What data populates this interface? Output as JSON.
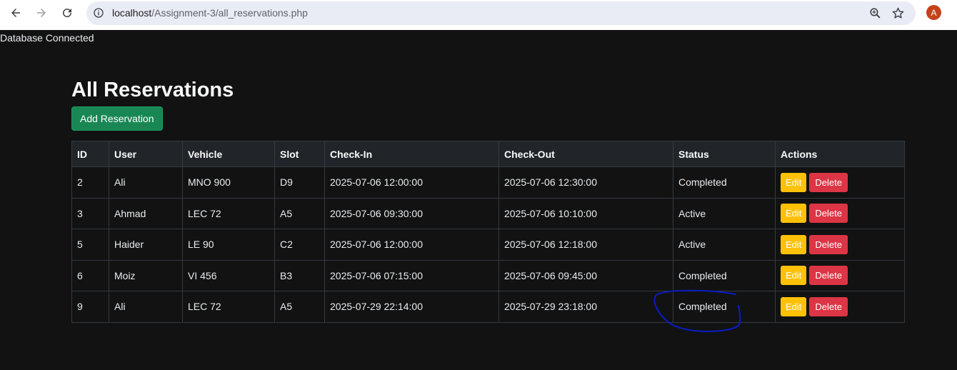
{
  "browser": {
    "url_host": "localhost",
    "url_path": "/Assignment-3/all_reservations.php",
    "profile_initial": "A",
    "icons": [
      "back-icon",
      "forward-icon",
      "reload-icon",
      "info-icon",
      "zoom-icon",
      "star-icon"
    ]
  },
  "status_text": "Database Connected",
  "page": {
    "title": "All Reservations",
    "add_button": "Add Reservation"
  },
  "table": {
    "headers": [
      "ID",
      "User",
      "Vehicle",
      "Slot",
      "Check-In",
      "Check-Out",
      "Status",
      "Actions"
    ],
    "rows": [
      {
        "id": "2",
        "user": "Ali",
        "vehicle": "MNO 900",
        "slot": "D9",
        "check_in": "2025-07-06 12:00:00",
        "check_out": "2025-07-06 12:30:00",
        "status": "Completed"
      },
      {
        "id": "3",
        "user": "Ahmad",
        "vehicle": "LEC 72",
        "slot": "A5",
        "check_in": "2025-07-06 09:30:00",
        "check_out": "2025-07-06 10:10:00",
        "status": "Active"
      },
      {
        "id": "5",
        "user": "Haider",
        "vehicle": "LE 90",
        "slot": "C2",
        "check_in": "2025-07-06 12:00:00",
        "check_out": "2025-07-06 12:18:00",
        "status": "Active"
      },
      {
        "id": "6",
        "user": "Moiz",
        "vehicle": "VI 456",
        "slot": "B3",
        "check_in": "2025-07-06 07:15:00",
        "check_out": "2025-07-06 09:45:00",
        "status": "Completed"
      },
      {
        "id": "9",
        "user": "Ali",
        "vehicle": "LEC 72",
        "slot": "A5",
        "check_in": "2025-07-29 22:14:00",
        "check_out": "2025-07-29 23:18:00",
        "status": "Completed"
      }
    ],
    "edit_label": "Edit",
    "delete_label": "Delete"
  },
  "colors": {
    "background": "#121212",
    "add_button": "#198754",
    "edit_button": "#ffc107",
    "delete_button": "#dc3545",
    "annotation_ink": "#0a1cc4"
  }
}
